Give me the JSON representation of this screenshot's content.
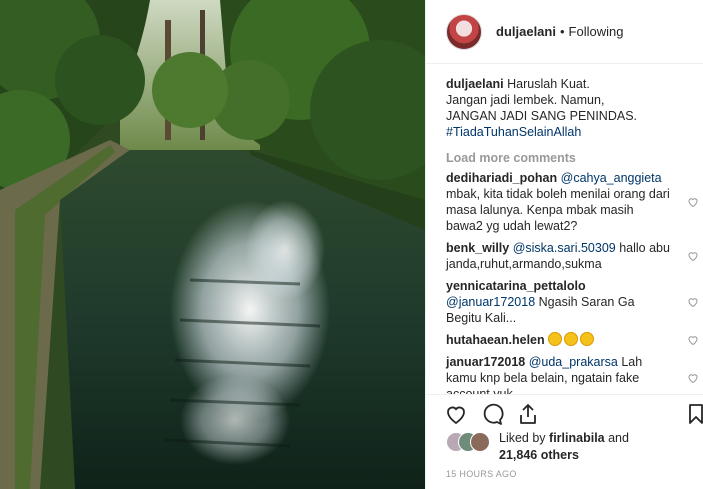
{
  "post": {
    "username": "duljaelani",
    "follow_status": "Following",
    "separator": "•"
  },
  "caption": {
    "username": "duljaelani",
    "text_lines": [
      "Haruslah Kuat.",
      "Jangan jadi lembek. Namun,",
      "JANGAN JADI SANG PENINDAS."
    ],
    "hashtag": "#TiadaTuhanSelainAllah"
  },
  "load_more": "Load more comments",
  "comments": [
    {
      "user": "dedihariadi_pohan",
      "mention": "@cahya_anggieta",
      "text": "mbak, kita tidak boleh menilai orang dari masa lalunya. Kenpa mbak masih bawa2 yg udah lewat2?"
    },
    {
      "user": "benk_willy",
      "mention": "@siska.sari.50309",
      "text": "hallo abu janda,ruhut,armando,sukma"
    },
    {
      "user": "yennicatarina_pettalolo",
      "mention": "@januar172018",
      "text": "Ngasih Saran Ga Begitu Kali..."
    },
    {
      "user": "hutahaean.helen",
      "mention": "",
      "text": ""
    },
    {
      "user": "januar172018",
      "mention": "@uda_prakarsa",
      "text": "Lah kamu knp bela belain, ngatain fake account yuk"
    }
  ],
  "likes": {
    "prefix": "Liked by",
    "user": "firlinabila",
    "joiner": "and",
    "count": "21,846 others"
  },
  "timestamp": "15 HOURS AGO",
  "icons": [
    "heart-icon",
    "comment-icon",
    "share-icon",
    "bookmark-icon"
  ],
  "colors": {
    "link": "#003569",
    "muted": "#999999",
    "text": "#262626"
  }
}
